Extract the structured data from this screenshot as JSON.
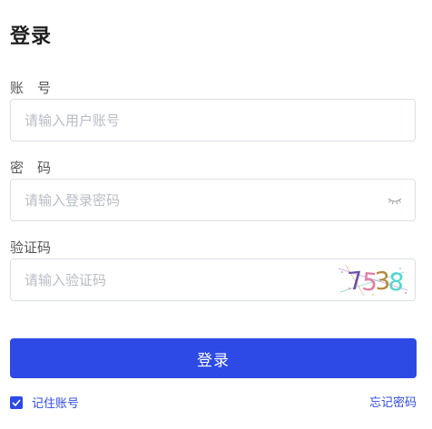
{
  "title": "登录",
  "account": {
    "label": "账　号",
    "placeholder": "请输入用户账号",
    "value": ""
  },
  "password": {
    "label": "密　码",
    "placeholder": "请输入登录密码",
    "value": "",
    "toggle_icon": "eye-closed-icon"
  },
  "captcha": {
    "label": "验证码",
    "placeholder": "请输入验证码",
    "value": "",
    "image_text": "7538"
  },
  "login_button": "登录",
  "remember": {
    "label": "记住账号",
    "checked": true
  },
  "forgot_link": "忘记密码",
  "colors": {
    "primary": "#2d4ae6",
    "border": "#dcdfe6",
    "placeholder": "#b8bcc4"
  }
}
